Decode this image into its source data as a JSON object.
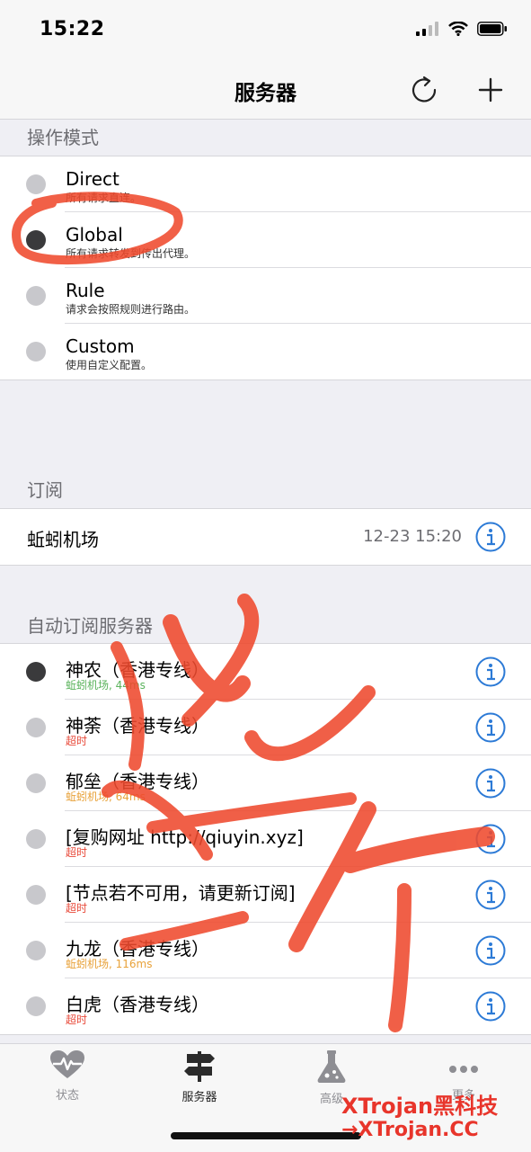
{
  "status_bar": {
    "time": "15:22"
  },
  "nav": {
    "title": "服务器",
    "refresh_icon": "refresh-icon",
    "add_icon": "plus-icon"
  },
  "mode_section": {
    "header": "操作模式",
    "items": [
      {
        "title": "Direct",
        "subtitle": "所有请求直连。",
        "selected": false
      },
      {
        "title": "Global",
        "subtitle": "所有请求转发到传出代理。",
        "selected": true
      },
      {
        "title": "Rule",
        "subtitle": "请求会按照规则进行路由。",
        "selected": false
      },
      {
        "title": "Custom",
        "subtitle": "使用自定义配置。",
        "selected": false
      }
    ]
  },
  "subscription_section": {
    "header": "订阅",
    "name": "蚯蚓机场",
    "updated": "12-23 15:20"
  },
  "servers_section": {
    "header": "自动订阅服务器",
    "items": [
      {
        "title": "神农（香港专线）",
        "subtitle": "蚯蚓机场, 44ms",
        "status": "green",
        "selected": true
      },
      {
        "title": "神荼（香港专线）",
        "subtitle": "超时",
        "status": "red",
        "selected": false
      },
      {
        "title": "郁垒（香港专线）",
        "subtitle": "蚯蚓机场, 64ms",
        "status": "orange",
        "selected": false
      },
      {
        "title": "[复购网址 http://qiuyin.xyz]",
        "subtitle": "超时",
        "status": "red",
        "selected": false
      },
      {
        "title": "[节点若不可用，请更新订阅]",
        "subtitle": "超时",
        "status": "red",
        "selected": false
      },
      {
        "title": "九龙（香港专线）",
        "subtitle": "蚯蚓机场, 116ms",
        "status": "orange",
        "selected": false
      },
      {
        "title": "白虎（香港专线）",
        "subtitle": "超时",
        "status": "red",
        "selected": false
      }
    ]
  },
  "tab_bar": {
    "tabs": [
      {
        "label": "状态",
        "icon": "heartbeat-icon"
      },
      {
        "label": "服务器",
        "icon": "signpost-icon",
        "active": true
      },
      {
        "label": "高级",
        "icon": "flask-icon"
      },
      {
        "label": "更多",
        "icon": "more-icon"
      }
    ]
  },
  "watermark": {
    "line1": "XTrojan黑科技",
    "line2": "→XTrojan.CC"
  },
  "colors": {
    "accent": "#2c7ad6",
    "latency_good": "#5bb35c",
    "latency_mid": "#e8a23a",
    "timeout": "#e84a3a",
    "scribble": "#ef4a2e"
  }
}
